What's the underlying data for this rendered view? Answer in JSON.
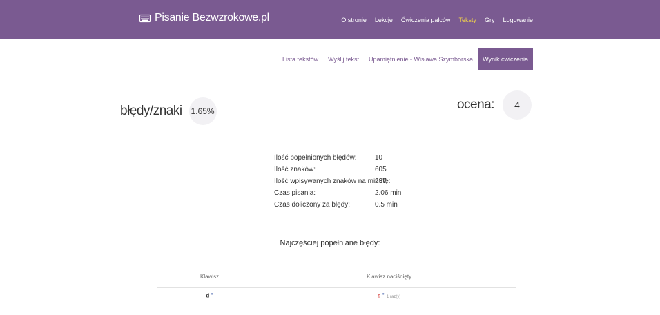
{
  "header": {
    "brand": "Pisanie Bezwzrokowe.pl",
    "brand_icon": "keyboard-icon",
    "nav": [
      {
        "label": "O stronie",
        "active": false
      },
      {
        "label": "Lekcje",
        "active": false
      },
      {
        "label": "Ćwiczenia palców",
        "active": false
      },
      {
        "label": "Teksty",
        "active": true
      },
      {
        "label": "Gry",
        "active": false
      },
      {
        "label": "Logowanie",
        "active": false
      }
    ]
  },
  "subnav": [
    {
      "label": "Lista tekstów",
      "active": false
    },
    {
      "label": "Wyślij tekst",
      "active": false
    },
    {
      "label": "Upamiętnienie - Wisława Szymborska",
      "active": false
    },
    {
      "label": "Wynik ćwiczenia",
      "active": true
    }
  ],
  "summary": {
    "errors_label": "błędy/znaki",
    "errors_value": "1.65%",
    "grade_label": "ocena:",
    "grade_value": "4"
  },
  "details": [
    {
      "label": "Ilość popełnionych błędów:",
      "value": "10"
    },
    {
      "label": "Ilość znaków:",
      "value": "605"
    },
    {
      "label": "Ilość wpisywanych znaków na minutę:",
      "value": "237"
    },
    {
      "label": "Czas pisania:",
      "value": "2.06 min"
    },
    {
      "label": "Czas doliczony za błędy:",
      "value": "0.5 min"
    }
  ],
  "errors_section": {
    "title": "Najczęściej popełniane błędy:",
    "columns": [
      "Klawisz",
      "Klawisz naciśnięty"
    ],
    "rows": [
      {
        "key": "d",
        "pressed": "s",
        "times": "1 raz(y)"
      }
    ]
  },
  "colors": {
    "brand": "#7a5a91",
    "active_nav": "#f0d24a",
    "wrong_key": "#d9534f"
  }
}
